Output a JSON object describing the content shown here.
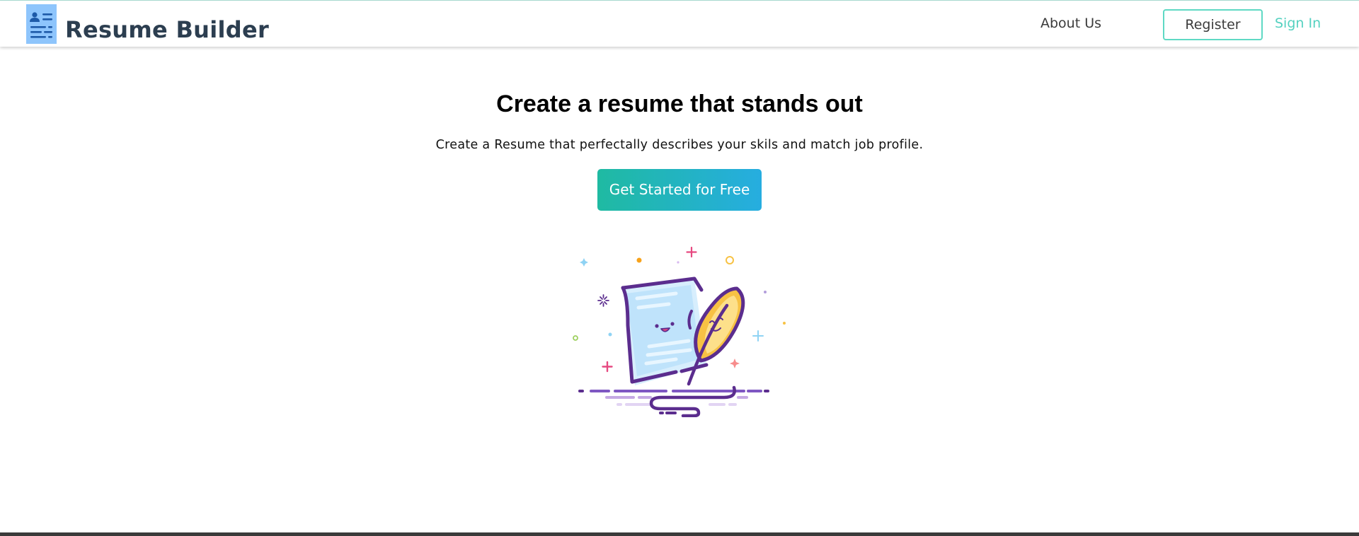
{
  "header": {
    "brand": "Resume Builder",
    "nav": {
      "about": "About Us",
      "register": "Register",
      "signin": "Sign In"
    },
    "icon": "resume-document-icon"
  },
  "hero": {
    "title": "Create a resume that stands out",
    "subtitle": "Create a Resume that perfectally describes your skils and match job profile.",
    "cta_label": "Get Started for Free",
    "illustration": "resume-and-feather-quill-illustration"
  },
  "colors": {
    "accent_teal": "#54d1c0",
    "register_border": "#5fd9c4",
    "cta_gradient_start": "#1fbaa2",
    "cta_gradient_end": "#26ade0",
    "brand_text": "#2c3e50",
    "logo_bg": "#8ec5fc"
  }
}
